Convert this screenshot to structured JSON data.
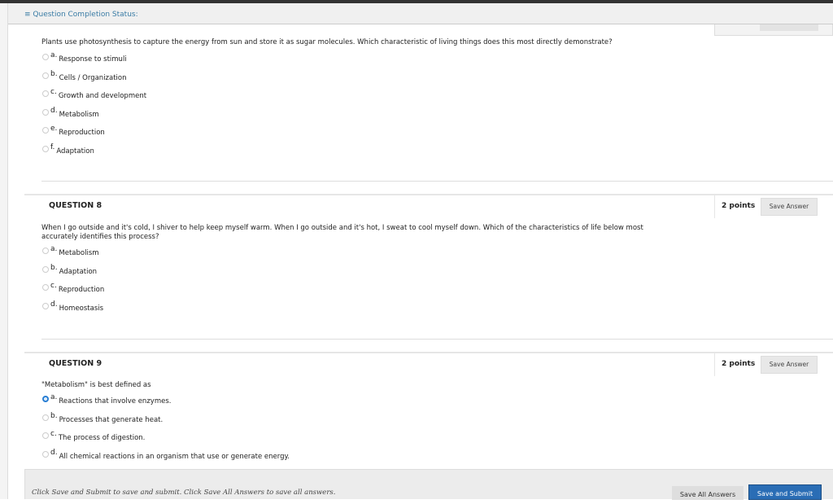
{
  "status": {
    "icon": "chevron-double-down-icon",
    "label": "Question Completion Status:"
  },
  "q7": {
    "text": "Plants use photosynthesis to capture the energy from sun and store it as sugar molecules. Which characteristic of living things does this most directly demonstrate?",
    "options": [
      {
        "l": "a.",
        "t": "Response to stimuli"
      },
      {
        "l": "b.",
        "t": "Cells / Organization"
      },
      {
        "l": "c.",
        "t": "Growth and development"
      },
      {
        "l": "d.",
        "t": "Metabolism"
      },
      {
        "l": "e.",
        "t": "Reproduction"
      },
      {
        "l": "f.",
        "t": "Adaptation"
      }
    ]
  },
  "q8": {
    "title": "QUESTION 8",
    "points": "2 points",
    "save": "Save Answer",
    "text": "When I go outside and it's cold, I shiver to help keep myself warm. When I go outside and it's hot, I sweat to cool myself down. Which of the characteristics of life below most accurately identifies this process?",
    "options": [
      {
        "l": "a.",
        "t": "Metabolism"
      },
      {
        "l": "b.",
        "t": "Adaptation"
      },
      {
        "l": "c.",
        "t": "Reproduction"
      },
      {
        "l": "d.",
        "t": "Homeostasis"
      }
    ]
  },
  "q9": {
    "title": "QUESTION 9",
    "points": "2 points",
    "save": "Save Answer",
    "text": "\"Metabolism\" is best defined as",
    "selected": "a",
    "options": [
      {
        "l": "a.",
        "t": "Reactions that involve enzymes."
      },
      {
        "l": "b.",
        "t": "Processes that generate heat."
      },
      {
        "l": "c.",
        "t": "The process of digestion."
      },
      {
        "l": "d.",
        "t": "All chemical reactions in an organism that use or generate energy."
      }
    ]
  },
  "footer": {
    "text": "Click Save and Submit to save and submit. Click Save All Answers to save all answers.",
    "save_all": "Save All Answers",
    "submit": "Save and Submit"
  },
  "colors": {
    "accent": "#2a6db5",
    "link": "#3a7ca5"
  }
}
